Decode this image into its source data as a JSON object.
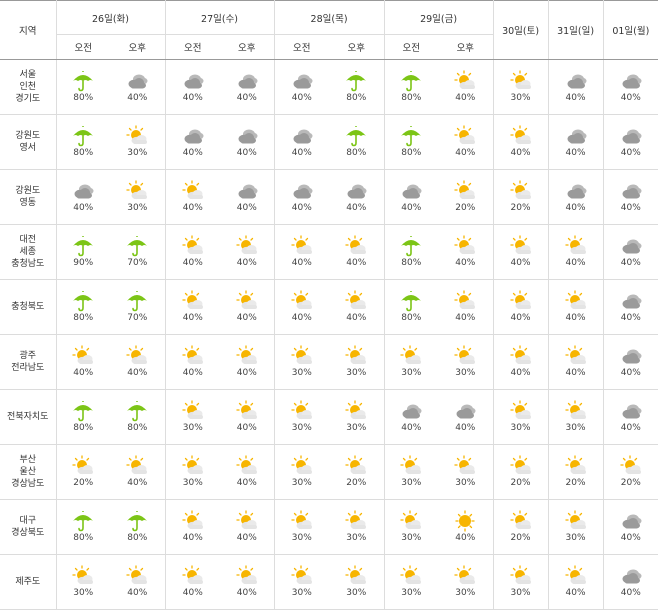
{
  "header": {
    "region_label": "지역",
    "days": [
      {
        "label": "26일(화)",
        "split": true
      },
      {
        "label": "27일(수)",
        "split": true
      },
      {
        "label": "28일(목)",
        "split": true
      },
      {
        "label": "29일(금)",
        "split": true
      },
      {
        "label": "30일(토)",
        "split": false
      },
      {
        "label": "31일(일)",
        "split": false
      },
      {
        "label": "01일(월)",
        "split": false
      }
    ],
    "am_label": "오전",
    "pm_label": "오후"
  },
  "rows": [
    {
      "region": [
        "서울",
        "인천",
        "경기도"
      ],
      "cells": [
        [
          "umbrella",
          "80%"
        ],
        [
          "cloudy",
          "40%"
        ],
        [
          "cloudy",
          "40%"
        ],
        [
          "cloudy",
          "40%"
        ],
        [
          "cloudy",
          "40%"
        ],
        [
          "umbrella",
          "80%"
        ],
        [
          "umbrella",
          "80%"
        ],
        [
          "partly-sunny",
          "40%"
        ],
        [
          "partly-sunny",
          "30%"
        ],
        [
          "cloudy",
          "40%"
        ],
        [
          "cloudy",
          "40%"
        ]
      ]
    },
    {
      "region": [
        "강원도",
        "영서"
      ],
      "cells": [
        [
          "umbrella",
          "80%"
        ],
        [
          "partly-sunny",
          "30%"
        ],
        [
          "cloudy",
          "40%"
        ],
        [
          "cloudy",
          "40%"
        ],
        [
          "cloudy",
          "40%"
        ],
        [
          "umbrella",
          "80%"
        ],
        [
          "umbrella",
          "80%"
        ],
        [
          "partly-sunny",
          "40%"
        ],
        [
          "partly-sunny",
          "40%"
        ],
        [
          "cloudy",
          "40%"
        ],
        [
          "cloudy",
          "40%"
        ]
      ]
    },
    {
      "region": [
        "강원도",
        "영동"
      ],
      "cells": [
        [
          "cloudy",
          "40%"
        ],
        [
          "partly-sunny",
          "30%"
        ],
        [
          "partly-sunny",
          "40%"
        ],
        [
          "cloudy",
          "40%"
        ],
        [
          "cloudy",
          "40%"
        ],
        [
          "cloudy",
          "40%"
        ],
        [
          "cloudy",
          "40%"
        ],
        [
          "partly-sunny",
          "20%"
        ],
        [
          "partly-sunny",
          "20%"
        ],
        [
          "cloudy",
          "40%"
        ],
        [
          "cloudy",
          "40%"
        ]
      ]
    },
    {
      "region": [
        "대전",
        "세종",
        "충청남도"
      ],
      "cells": [
        [
          "umbrella",
          "90%"
        ],
        [
          "umbrella",
          "70%"
        ],
        [
          "partly-sunny",
          "40%"
        ],
        [
          "partly-sunny",
          "40%"
        ],
        [
          "partly-sunny",
          "40%"
        ],
        [
          "partly-sunny",
          "40%"
        ],
        [
          "umbrella",
          "80%"
        ],
        [
          "partly-sunny",
          "40%"
        ],
        [
          "partly-sunny",
          "40%"
        ],
        [
          "partly-sunny",
          "40%"
        ],
        [
          "cloudy",
          "40%"
        ]
      ]
    },
    {
      "region": [
        "충청북도"
      ],
      "cells": [
        [
          "umbrella",
          "80%"
        ],
        [
          "umbrella",
          "70%"
        ],
        [
          "partly-sunny",
          "40%"
        ],
        [
          "partly-sunny",
          "40%"
        ],
        [
          "partly-sunny",
          "40%"
        ],
        [
          "partly-sunny",
          "40%"
        ],
        [
          "umbrella",
          "80%"
        ],
        [
          "partly-sunny",
          "40%"
        ],
        [
          "partly-sunny",
          "40%"
        ],
        [
          "partly-sunny",
          "40%"
        ],
        [
          "cloudy",
          "40%"
        ]
      ]
    },
    {
      "region": [
        "광주",
        "전라남도"
      ],
      "cells": [
        [
          "partly-sunny",
          "40%"
        ],
        [
          "partly-sunny",
          "40%"
        ],
        [
          "partly-sunny",
          "40%"
        ],
        [
          "partly-sunny",
          "40%"
        ],
        [
          "partly-sunny",
          "30%"
        ],
        [
          "partly-sunny",
          "30%"
        ],
        [
          "partly-sunny",
          "30%"
        ],
        [
          "partly-sunny",
          "30%"
        ],
        [
          "partly-sunny",
          "40%"
        ],
        [
          "partly-sunny",
          "40%"
        ],
        [
          "cloudy",
          "40%"
        ]
      ]
    },
    {
      "region": [
        "전북자치도"
      ],
      "cells": [
        [
          "umbrella",
          "80%"
        ],
        [
          "umbrella",
          "80%"
        ],
        [
          "partly-sunny",
          "30%"
        ],
        [
          "partly-sunny",
          "40%"
        ],
        [
          "partly-sunny",
          "30%"
        ],
        [
          "partly-sunny",
          "30%"
        ],
        [
          "cloudy",
          "40%"
        ],
        [
          "cloudy",
          "40%"
        ],
        [
          "partly-sunny",
          "30%"
        ],
        [
          "partly-sunny",
          "30%"
        ],
        [
          "cloudy",
          "40%"
        ]
      ]
    },
    {
      "region": [
        "부산",
        "울산",
        "경상남도"
      ],
      "cells": [
        [
          "partly-sunny",
          "20%"
        ],
        [
          "partly-sunny",
          "40%"
        ],
        [
          "partly-sunny",
          "30%"
        ],
        [
          "partly-sunny",
          "40%"
        ],
        [
          "partly-sunny",
          "30%"
        ],
        [
          "partly-sunny",
          "20%"
        ],
        [
          "partly-sunny",
          "30%"
        ],
        [
          "partly-sunny",
          "30%"
        ],
        [
          "partly-sunny",
          "20%"
        ],
        [
          "partly-sunny",
          "20%"
        ],
        [
          "partly-sunny",
          "20%"
        ]
      ]
    },
    {
      "region": [
        "대구",
        "경상북도"
      ],
      "cells": [
        [
          "umbrella",
          "80%"
        ],
        [
          "umbrella",
          "80%"
        ],
        [
          "partly-sunny",
          "40%"
        ],
        [
          "partly-sunny",
          "40%"
        ],
        [
          "partly-sunny",
          "30%"
        ],
        [
          "partly-sunny",
          "30%"
        ],
        [
          "partly-sunny",
          "30%"
        ],
        [
          "sunny",
          "40%"
        ],
        [
          "partly-sunny",
          "20%"
        ],
        [
          "partly-sunny",
          "30%"
        ],
        [
          "cloudy",
          "40%"
        ]
      ]
    },
    {
      "region": [
        "제주도"
      ],
      "cells": [
        [
          "partly-sunny",
          "30%"
        ],
        [
          "partly-sunny",
          "40%"
        ],
        [
          "partly-sunny",
          "40%"
        ],
        [
          "partly-sunny",
          "40%"
        ],
        [
          "partly-sunny",
          "30%"
        ],
        [
          "partly-sunny",
          "30%"
        ],
        [
          "partly-sunny",
          "30%"
        ],
        [
          "partly-sunny",
          "30%"
        ],
        [
          "partly-sunny",
          "30%"
        ],
        [
          "partly-sunny",
          "40%"
        ],
        [
          "cloudy",
          "40%"
        ]
      ]
    }
  ],
  "colors": {
    "umbrella": "#7cc516",
    "sun": "#f7b500",
    "cloud": "#9a9a9a",
    "border": "#dcdcdc"
  }
}
